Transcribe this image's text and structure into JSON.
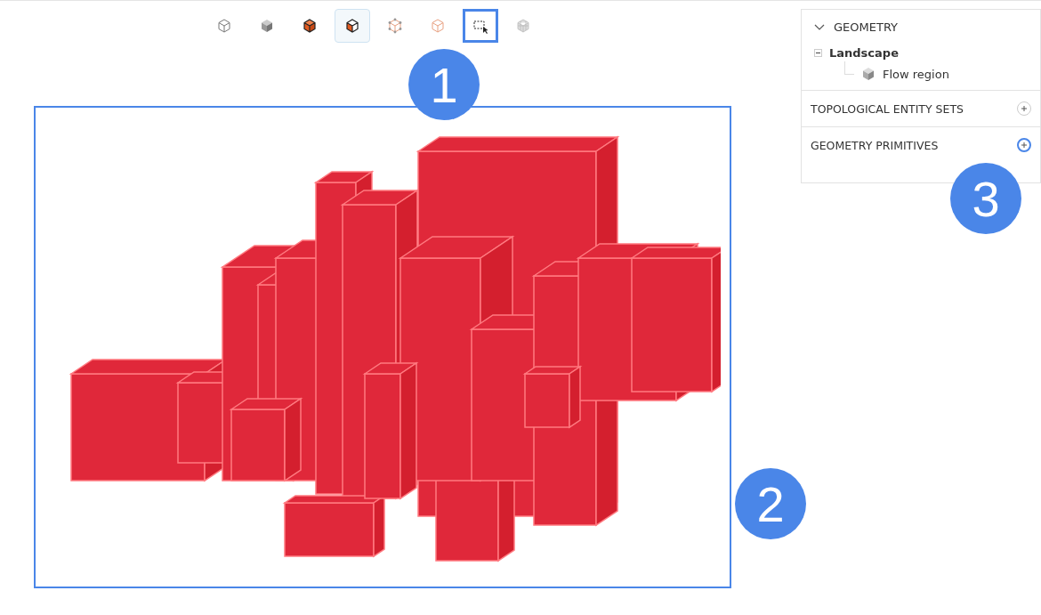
{
  "toolbar": [
    {
      "kind": "outline",
      "selected": false,
      "highlighted": false
    },
    {
      "kind": "shaded",
      "selected": false,
      "highlighted": false
    },
    {
      "kind": "solid",
      "selected": false,
      "highlighted": false
    },
    {
      "kind": "solid-edges",
      "selected": true,
      "highlighted": false
    },
    {
      "kind": "vertices",
      "selected": false,
      "highlighted": false
    },
    {
      "kind": "edges",
      "selected": false,
      "highlighted": false
    },
    {
      "kind": "box-select",
      "selected": false,
      "highlighted": true
    },
    {
      "kind": "mesh",
      "selected": false,
      "highlighted": false
    }
  ],
  "viewport": {
    "highlighted": true
  },
  "tree": {
    "title": "GEOMETRY",
    "expanded": true,
    "children": [
      {
        "label": "Landscape",
        "expanded": true,
        "children": [
          {
            "label": "Flow region"
          }
        ]
      }
    ]
  },
  "sections": [
    {
      "title": "TOPOLOGICAL ENTITY SETS",
      "highlighted": false
    },
    {
      "title": "GEOMETRY PRIMITIVES",
      "highlighted": true
    }
  ],
  "callouts": [
    "1",
    "2",
    "3"
  ]
}
